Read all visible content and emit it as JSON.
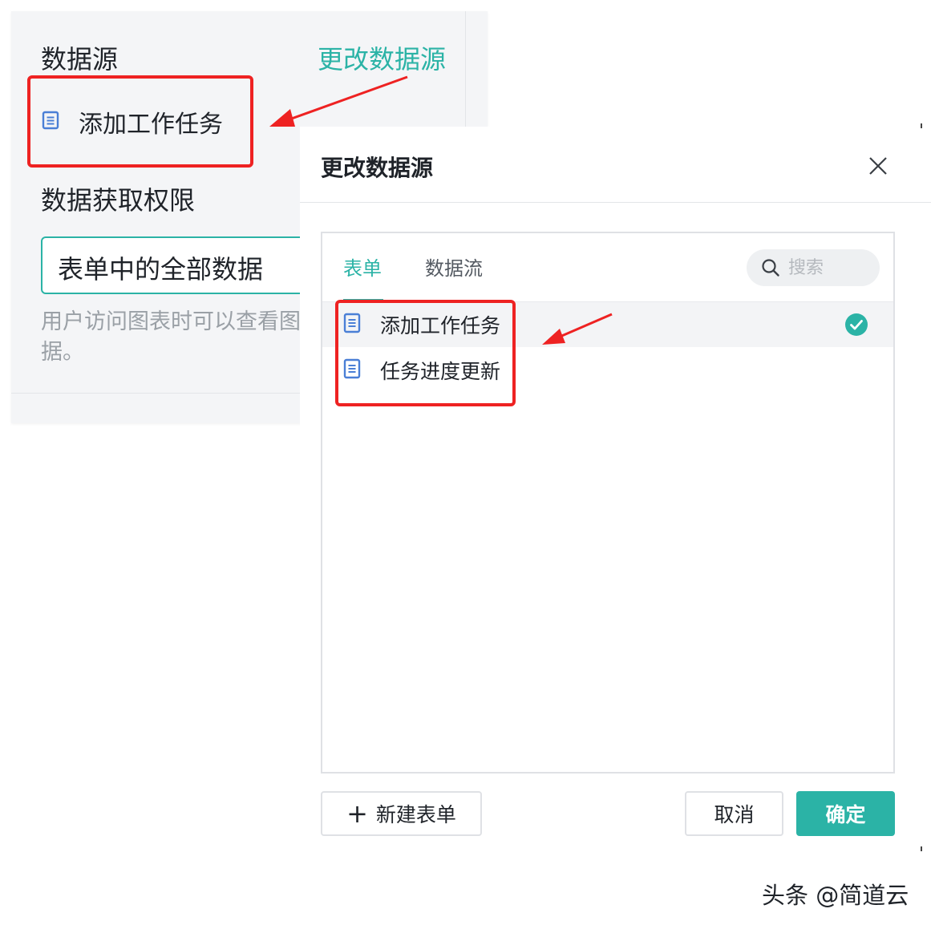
{
  "left_panel": {
    "data_source_title": "数据源",
    "change_source_link": "更改数据源",
    "source_item": {
      "label": "添加工作任务",
      "icon": "form-doc-icon"
    },
    "permission_title": "数据获取权限",
    "permission_select_value": "表单中的全部数据",
    "permission_hint": "用户访问图表时可以查看图据。"
  },
  "dialog": {
    "title": "更改数据源",
    "tabs": [
      {
        "label": "表单",
        "active": true
      },
      {
        "label": "数据流",
        "active": false
      }
    ],
    "search": {
      "placeholder": "搜索"
    },
    "items": [
      {
        "label": "添加工作任务",
        "selected": true,
        "icon": "form-doc-icon"
      },
      {
        "label": "任务进度更新",
        "selected": false,
        "icon": "form-doc-icon"
      }
    ],
    "new_form_button": "新建表单",
    "new_form_icon": "plus-icon",
    "cancel_button": "取消",
    "confirm_button": "确定"
  },
  "watermark": "头条 @简道云",
  "colors": {
    "accent": "#2bb3a6",
    "annotation": "#ee2222",
    "doc_icon": "#4a7fd6"
  }
}
